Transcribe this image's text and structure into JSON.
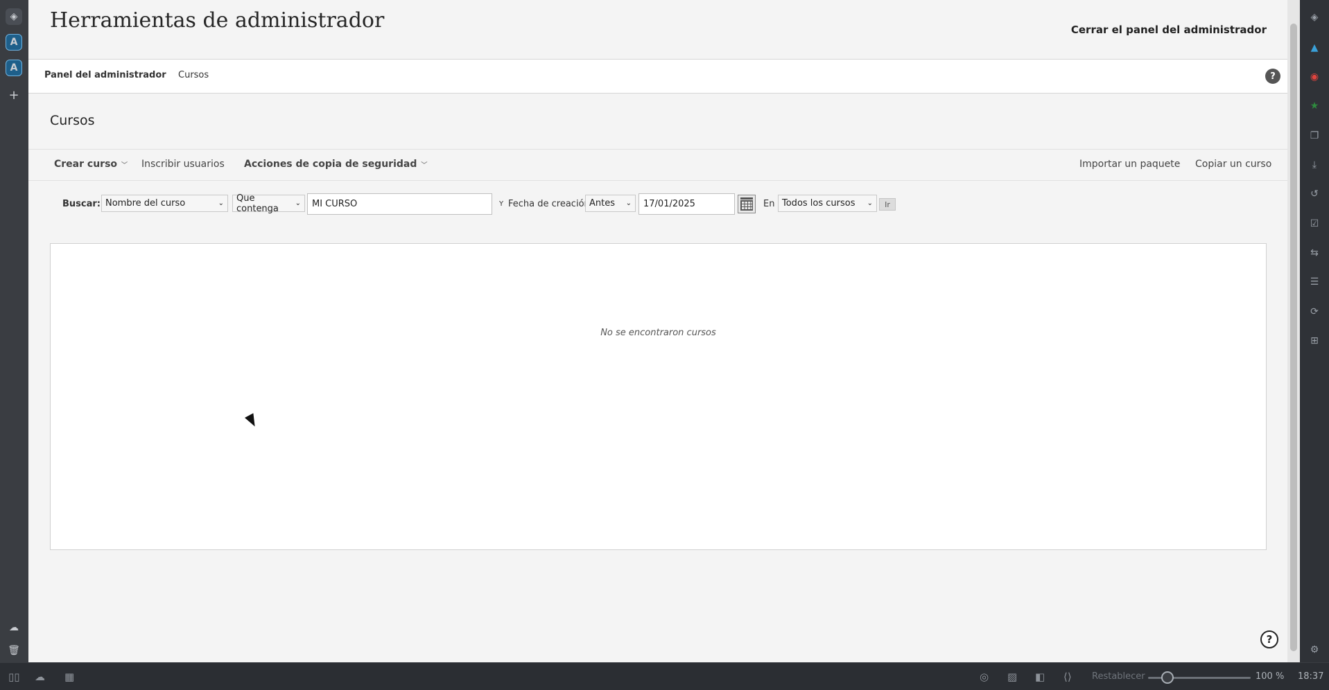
{
  "page": {
    "title": "Herramientas de administrador",
    "close_panel": "Cerrar el panel del administrador"
  },
  "breadcrumb": {
    "items": [
      "Panel del administrador",
      "Cursos"
    ]
  },
  "section": {
    "title": "Cursos"
  },
  "actions": {
    "create_course": "Crear curso",
    "enroll_users": "Inscribir usuarios",
    "backup_actions": "Acciones de copia de seguridad",
    "import_package": "Importar un paquete",
    "copy_course": "Copiar un curso"
  },
  "search": {
    "label": "Buscar:",
    "field_selected": "Nombre del curso",
    "operator_selected": "Que contenga",
    "query_value": "MI CURSO",
    "and_label": "Y",
    "date_label": "Fecha de creación",
    "date_operator_selected": "Antes",
    "date_value": "17/01/2025",
    "in_label": "En",
    "scope_selected": "Todos los cursos",
    "go_label": "Ir"
  },
  "results": {
    "empty_message": "No se encontraron cursos"
  },
  "help_badge": "?",
  "statusbar": {
    "reset_label": "Restablecer",
    "zoom": "100 %",
    "zoom_level_percent": 100,
    "time": "18:37"
  },
  "colors": {
    "page_bg": "#f4f4f4",
    "chrome_bg": "#2b2e33",
    "rail_app_accent": "#1e5f8a",
    "panel_border": "#d0d0d0"
  }
}
